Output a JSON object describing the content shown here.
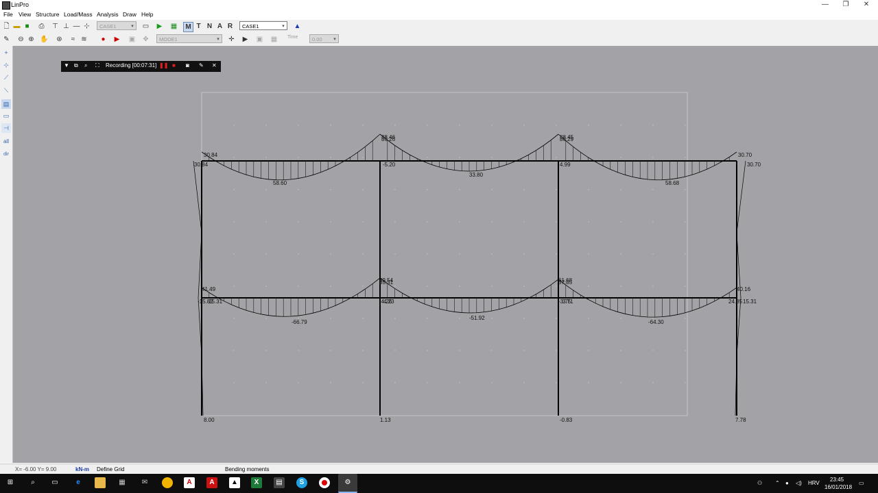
{
  "window": {
    "title": "LinPro"
  },
  "menu": [
    "File",
    "View",
    "Structure",
    "Load/Mass",
    "Analysis",
    "Draw",
    "Help"
  ],
  "toolbar": {
    "load_case": "CASE1",
    "case_select": "CASE1",
    "mode_select": "MODE1",
    "time_label": "Time",
    "time_value": "0.00"
  },
  "leftbar": {
    "all_label": "all",
    "dir_label": "dir"
  },
  "recorder": {
    "label": "Recording [00:07:31]"
  },
  "diagram": {
    "labels": [
      {
        "t": "30.84"
      },
      {
        "t": "30.84"
      },
      {
        "t": "58.60"
      },
      {
        "t": "88.46"
      },
      {
        "t": "86.26"
      },
      {
        "t": "-5.20"
      },
      {
        "t": "33.80"
      },
      {
        "t": "88.45"
      },
      {
        "t": "86.29"
      },
      {
        "t": "4.99"
      },
      {
        "t": "58.68"
      },
      {
        "t": "30.70"
      },
      {
        "t": "30.70"
      },
      {
        "t": "41.49"
      },
      {
        "t": "-15.82"
      },
      {
        "t": "25.31"
      },
      {
        "t": "-66.79"
      },
      {
        "t": "69.54"
      },
      {
        "t": "65.31"
      },
      {
        "t": "-4.26"
      },
      {
        "t": "4.23"
      },
      {
        "t": "-51.92"
      },
      {
        "t": "61.68"
      },
      {
        "t": "57.85"
      },
      {
        "t": "-3.75"
      },
      {
        "t": "3.71"
      },
      {
        "t": "-64.30"
      },
      {
        "t": "40.16"
      },
      {
        "t": "24.85"
      },
      {
        "t": "15.31"
      },
      {
        "t": "8.00"
      },
      {
        "t": "1.13"
      },
      {
        "t": "-0.83"
      },
      {
        "t": "7.78"
      }
    ]
  },
  "status": {
    "coords": "X= -6.00  Y= 9.00",
    "units": "kN-m",
    "mode": "Define Grid",
    "view": "Bending moments"
  },
  "taskbar": {
    "lang": "HRV",
    "time": "23:45",
    "date": "16/01/2018"
  }
}
